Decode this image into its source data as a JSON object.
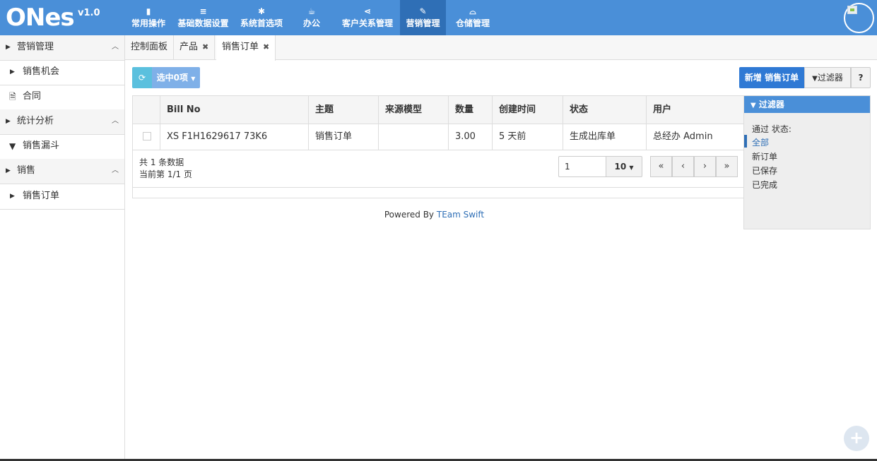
{
  "app": {
    "brand": "ONes",
    "version": "v1.0"
  },
  "nav": [
    {
      "icon": "bookmark-icon",
      "glyph": "▮",
      "label": "常用操作"
    },
    {
      "icon": "list-icon",
      "glyph": "≡",
      "label": "基础数据设置"
    },
    {
      "icon": "gear-icon",
      "glyph": "✱",
      "label": "系统首选项"
    },
    {
      "icon": "coffee-icon",
      "glyph": "☕",
      "label": "办公"
    },
    {
      "icon": "share-icon",
      "glyph": "⋖",
      "label": "客户关系管理"
    },
    {
      "icon": "pencil-icon",
      "glyph": "✎",
      "label": "营销管理"
    },
    {
      "icon": "inbox-icon",
      "glyph": "⌓",
      "label": "仓储管理"
    }
  ],
  "sidebar": {
    "groups": [
      {
        "label": "营销管理",
        "items": [
          {
            "icon": "caret-right-icon",
            "label": "销售机会"
          },
          {
            "icon": "file-icon",
            "label": "合同"
          }
        ]
      },
      {
        "label": "统计分析",
        "items": [
          {
            "icon": "filter-icon",
            "label": "销售漏斗"
          }
        ]
      },
      {
        "label": "销售",
        "items": [
          {
            "icon": "caret-right-icon",
            "label": "销售订单"
          }
        ]
      }
    ]
  },
  "tabs": [
    {
      "label": "控制面板",
      "closable": false
    },
    {
      "label": "产品",
      "closable": true
    },
    {
      "label": "销售订单",
      "closable": true
    }
  ],
  "toolbar": {
    "selected_label": "选中0项",
    "new_label": "新增 销售订单",
    "filter_label": "过滤器",
    "help_label": "?"
  },
  "table": {
    "columns": [
      "Bill No",
      "主题",
      "来源模型",
      "数量",
      "创建时间",
      "状态",
      "用户"
    ],
    "rows": [
      [
        "XS F1H1629617 73K6",
        "销售订单",
        "",
        "3.00",
        "5 天前",
        "生成出库单",
        "总经办 Admin"
      ]
    ],
    "total_text": "共 1 条数据",
    "page_text": "当前第 1/1 页",
    "page_input": "1",
    "page_size": "10"
  },
  "footer": {
    "powered_by": "Powered By",
    "team": "TEam Swift"
  },
  "filter_panel": {
    "title": "过滤器",
    "field_label": "通过 状态:",
    "options": [
      "全部",
      "新订单",
      "已保存",
      "已完成"
    ],
    "selected": "全部"
  },
  "colors": {
    "navbar": "#4a8fd8",
    "nav_active": "#2f6fb6",
    "primary": "#2f79d4",
    "info": "#5bc0de"
  }
}
